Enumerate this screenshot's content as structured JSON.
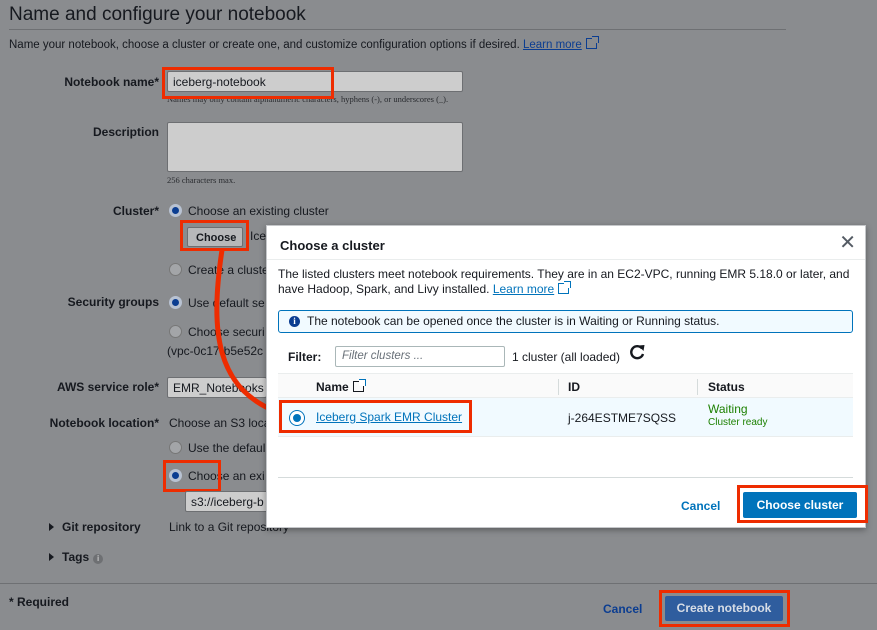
{
  "page": {
    "title": "Name and configure your notebook",
    "description": "Name your notebook, choose a cluster or create one, and customize configuration options if desired.",
    "learn_more": "Learn more"
  },
  "form": {
    "notebook_name_label": "Notebook name*",
    "notebook_name_value": "iceberg-notebook",
    "notebook_name_help": "Names may only contain alphanumeric characters, hyphens (-), or underscores (_).",
    "description_label": "Description",
    "description_help": "256 characters max.",
    "cluster_label": "Cluster*",
    "cluster_option_existing": "Choose an existing cluster",
    "choose_button": "Choose",
    "cluster_selected_partial": "Ice",
    "cluster_option_create": "Create a cluste",
    "security_groups_label": "Security groups",
    "security_option_default": "Use default se",
    "security_option_choose": "Choose securi",
    "security_vpc": "(vpc-0c17-b5e52c",
    "service_role_label": "AWS service role*",
    "service_role_value": "EMR_Notebooks",
    "location_label": "Notebook location*",
    "location_text": "Choose an S3 loca",
    "location_option_default": "Use the defaul",
    "location_option_existing": "Choose an exi",
    "location_value": "s3://iceberg-b",
    "git_repo_label": "Git repository",
    "git_repo_text": "Link to a Git repository",
    "tags_label": "Tags",
    "required_note": "* Required",
    "cancel": "Cancel",
    "create_notebook": "Create notebook"
  },
  "modal": {
    "title": "Choose a cluster",
    "close_glyph": "✕",
    "description": "The listed clusters meet notebook requirements. They are in an EC2-VPC, running EMR 5.18.0 or later, and have Hadoop, Spark, and Livy installed.",
    "learn_more": "Learn more",
    "info_message": "The notebook can be opened once the cluster is in Waiting or Running status.",
    "filter_label": "Filter:",
    "filter_placeholder": "Filter clusters ...",
    "filter_count": "1 cluster (all loaded)",
    "columns": {
      "name": "Name",
      "id": "ID",
      "status": "Status"
    },
    "rows": [
      {
        "name": "Iceberg Spark EMR Cluster",
        "id": "j-264ESTME7SQSS",
        "status": "Waiting",
        "status_detail": "Cluster ready"
      }
    ],
    "cancel": "Cancel",
    "choose_cluster": "Choose cluster"
  },
  "colors": {
    "highlight": "#ee2c00",
    "primary": "#0073bb",
    "status_ok": "#1d8102"
  }
}
